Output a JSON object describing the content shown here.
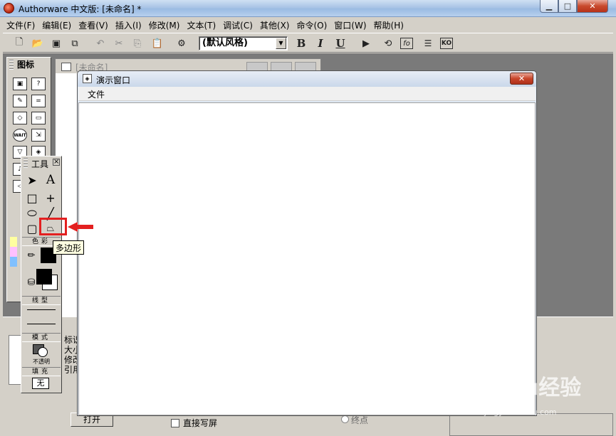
{
  "app": {
    "title": "Authorware 中文版: [未命名] *"
  },
  "menubar": {
    "items": [
      "文件(F)",
      "编辑(E)",
      "查看(V)",
      "插入(I)",
      "修改(M)",
      "文本(T)",
      "调试(C)",
      "其他(X)",
      "命令(O)",
      "窗口(W)",
      "帮助(H)"
    ]
  },
  "toolbar": {
    "style_select_value": "(默认风格)",
    "bold_label": "B",
    "italic_label": "I",
    "underline_label": "U"
  },
  "icon_palette": {
    "title": "图标"
  },
  "design_window": {
    "title": "[未命名]"
  },
  "presentation_window": {
    "title": "演示窗口",
    "menu_file": "文件"
  },
  "tools_palette": {
    "title": "工具",
    "color_section": "色彩",
    "line_section": "线型",
    "mode_section": "模式",
    "mode_value": "不透明",
    "fill_section": "填充",
    "fill_value": "无"
  },
  "tooltip": {
    "text": "多边形"
  },
  "bottom_panel": {
    "open_button": "打开",
    "direct_checkbox_label": "直接写屏",
    "end_radio_label": "终点",
    "props_labels": [
      "标识",
      "大小",
      "修改",
      "引用"
    ]
  },
  "watermark": {
    "text": "Baidu经验",
    "url": "jingyan.baidu.com"
  },
  "colors": {
    "highlight": "#e32020",
    "tooltip_bg": "#ffffe1"
  }
}
